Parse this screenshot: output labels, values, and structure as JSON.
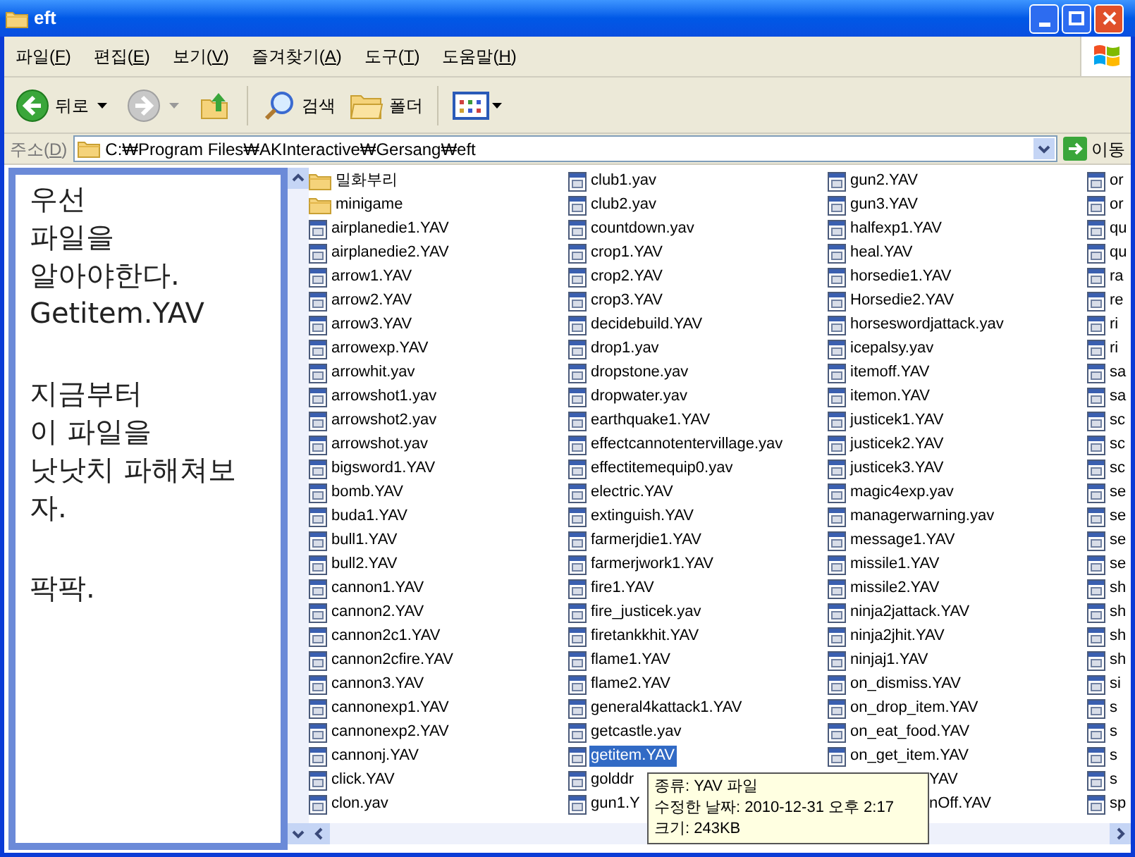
{
  "window": {
    "title": "eft"
  },
  "menu": [
    {
      "label": "파일(F)"
    },
    {
      "label": "편집(E)"
    },
    {
      "label": "보기(V)"
    },
    {
      "label": "즐겨찾기(A)"
    },
    {
      "label": "도구(T)"
    },
    {
      "label": "도움말(H)"
    }
  ],
  "toolbar": {
    "back": "뒤로",
    "search": "검색",
    "folders": "폴더"
  },
  "address": {
    "label": "주소(D)",
    "path": "C:₩Program Files₩AKInteractive₩Gersang₩eft",
    "go": "이동"
  },
  "note": {
    "paragraphs": [
      [
        "우선",
        "파일을",
        "알아야한다.",
        "Getitem.YAV"
      ],
      [
        "지금부터",
        "이 파일을",
        "낫낫치 파해쳐보",
        "자."
      ],
      [
        "팍팍."
      ]
    ]
  },
  "files": {
    "columns": [
      [
        {
          "name": "밀화부리",
          "kind": "folder",
          "selected": false
        },
        {
          "name": "minigame",
          "kind": "folder",
          "selected": false
        },
        {
          "name": "airplanedie1.YAV",
          "kind": "file",
          "selected": false
        },
        {
          "name": "airplanedie2.YAV",
          "kind": "file",
          "selected": false
        },
        {
          "name": "arrow1.YAV",
          "kind": "file",
          "selected": false
        },
        {
          "name": "arrow2.YAV",
          "kind": "file",
          "selected": false
        },
        {
          "name": "arrow3.YAV",
          "kind": "file",
          "selected": false
        },
        {
          "name": "arrowexp.YAV",
          "kind": "file",
          "selected": false
        },
        {
          "name": "arrowhit.yav",
          "kind": "file",
          "selected": false
        },
        {
          "name": "arrowshot1.yav",
          "kind": "file",
          "selected": false
        },
        {
          "name": "arrowshot2.yav",
          "kind": "file",
          "selected": false
        },
        {
          "name": "arrowshot.yav",
          "kind": "file",
          "selected": false
        },
        {
          "name": "bigsword1.YAV",
          "kind": "file",
          "selected": false
        },
        {
          "name": "bomb.YAV",
          "kind": "file",
          "selected": false
        },
        {
          "name": "buda1.YAV",
          "kind": "file",
          "selected": false
        },
        {
          "name": "bull1.YAV",
          "kind": "file",
          "selected": false
        },
        {
          "name": "bull2.YAV",
          "kind": "file",
          "selected": false
        },
        {
          "name": "cannon1.YAV",
          "kind": "file",
          "selected": false
        },
        {
          "name": "cannon2.YAV",
          "kind": "file",
          "selected": false
        },
        {
          "name": "cannon2c1.YAV",
          "kind": "file",
          "selected": false
        },
        {
          "name": "cannon2cfire.YAV",
          "kind": "file",
          "selected": false
        },
        {
          "name": "cannon3.YAV",
          "kind": "file",
          "selected": false
        },
        {
          "name": "cannonexp1.YAV",
          "kind": "file",
          "selected": false
        },
        {
          "name": "cannonexp2.YAV",
          "kind": "file",
          "selected": false
        },
        {
          "name": "cannonj.YAV",
          "kind": "file",
          "selected": false
        },
        {
          "name": "click.YAV",
          "kind": "file",
          "selected": false
        },
        {
          "name": "clon.yav",
          "kind": "file",
          "selected": false
        }
      ],
      [
        {
          "name": "club1.yav",
          "kind": "file",
          "selected": false
        },
        {
          "name": "club2.yav",
          "kind": "file",
          "selected": false
        },
        {
          "name": "countdown.yav",
          "kind": "file",
          "selected": false
        },
        {
          "name": "crop1.YAV",
          "kind": "file",
          "selected": false
        },
        {
          "name": "crop2.YAV",
          "kind": "file",
          "selected": false
        },
        {
          "name": "crop3.YAV",
          "kind": "file",
          "selected": false
        },
        {
          "name": "decidebuild.YAV",
          "kind": "file",
          "selected": false
        },
        {
          "name": "drop1.yav",
          "kind": "file",
          "selected": false
        },
        {
          "name": "dropstone.yav",
          "kind": "file",
          "selected": false
        },
        {
          "name": "dropwater.yav",
          "kind": "file",
          "selected": false
        },
        {
          "name": "earthquake1.YAV",
          "kind": "file",
          "selected": false
        },
        {
          "name": "effectcannotentervillage.yav",
          "kind": "file",
          "selected": false
        },
        {
          "name": "effectitemequip0.yav",
          "kind": "file",
          "selected": false
        },
        {
          "name": "electric.YAV",
          "kind": "file",
          "selected": false
        },
        {
          "name": "extinguish.YAV",
          "kind": "file",
          "selected": false
        },
        {
          "name": "farmerjdie1.YAV",
          "kind": "file",
          "selected": false
        },
        {
          "name": "farmerjwork1.YAV",
          "kind": "file",
          "selected": false
        },
        {
          "name": "fire1.YAV",
          "kind": "file",
          "selected": false
        },
        {
          "name": "fire_justicek.yav",
          "kind": "file",
          "selected": false
        },
        {
          "name": "firetankkhit.YAV",
          "kind": "file",
          "selected": false
        },
        {
          "name": "flame1.YAV",
          "kind": "file",
          "selected": false
        },
        {
          "name": "flame2.YAV",
          "kind": "file",
          "selected": false
        },
        {
          "name": "general4kattack1.YAV",
          "kind": "file",
          "selected": false
        },
        {
          "name": "getcastle.yav",
          "kind": "file",
          "selected": false
        },
        {
          "name": "getitem.YAV",
          "kind": "file",
          "selected": true
        },
        {
          "name": "golddr",
          "kind": "file",
          "selected": false
        },
        {
          "name": "gun1.Y",
          "kind": "file",
          "selected": false
        }
      ],
      [
        {
          "name": "gun2.YAV",
          "kind": "file",
          "selected": false
        },
        {
          "name": "gun3.YAV",
          "kind": "file",
          "selected": false
        },
        {
          "name": "halfexp1.YAV",
          "kind": "file",
          "selected": false
        },
        {
          "name": "heal.YAV",
          "kind": "file",
          "selected": false
        },
        {
          "name": "horsedie1.YAV",
          "kind": "file",
          "selected": false
        },
        {
          "name": "Horsedie2.YAV",
          "kind": "file",
          "selected": false
        },
        {
          "name": "horseswordjattack.yav",
          "kind": "file",
          "selected": false
        },
        {
          "name": "icepalsy.yav",
          "kind": "file",
          "selected": false
        },
        {
          "name": "itemoff.YAV",
          "kind": "file",
          "selected": false
        },
        {
          "name": "itemon.YAV",
          "kind": "file",
          "selected": false
        },
        {
          "name": "justicek1.YAV",
          "kind": "file",
          "selected": false
        },
        {
          "name": "justicek2.YAV",
          "kind": "file",
          "selected": false
        },
        {
          "name": "justicek3.YAV",
          "kind": "file",
          "selected": false
        },
        {
          "name": "magic4exp.yav",
          "kind": "file",
          "selected": false
        },
        {
          "name": "managerwarning.yav",
          "kind": "file",
          "selected": false
        },
        {
          "name": "message1.YAV",
          "kind": "file",
          "selected": false
        },
        {
          "name": "missile1.YAV",
          "kind": "file",
          "selected": false
        },
        {
          "name": "missile2.YAV",
          "kind": "file",
          "selected": false
        },
        {
          "name": "ninja2jattack.YAV",
          "kind": "file",
          "selected": false
        },
        {
          "name": "ninja2jhit.YAV",
          "kind": "file",
          "selected": false
        },
        {
          "name": "ninjaj1.YAV",
          "kind": "file",
          "selected": false
        },
        {
          "name": "on_dismiss.YAV",
          "kind": "file",
          "selected": false
        },
        {
          "name": "on_drop_item.YAV",
          "kind": "file",
          "selected": false
        },
        {
          "name": "on_eat_food.YAV",
          "kind": "file",
          "selected": false
        },
        {
          "name": "on_get_item.YAV",
          "kind": "file",
          "selected": false
        },
        {
          "name": "YAV",
          "kind": "covered"
        },
        {
          "name": "nOff.YAV",
          "kind": "covered"
        }
      ],
      [
        {
          "name": "or",
          "kind": "file",
          "selected": false
        },
        {
          "name": "or",
          "kind": "file",
          "selected": false
        },
        {
          "name": "qu",
          "kind": "file",
          "selected": false
        },
        {
          "name": "qu",
          "kind": "file",
          "selected": false
        },
        {
          "name": "ra",
          "kind": "file",
          "selected": false
        },
        {
          "name": "re",
          "kind": "file",
          "selected": false
        },
        {
          "name": "ri",
          "kind": "file",
          "selected": false
        },
        {
          "name": "ri",
          "kind": "file",
          "selected": false
        },
        {
          "name": "sa",
          "kind": "file",
          "selected": false
        },
        {
          "name": "sa",
          "kind": "file",
          "selected": false
        },
        {
          "name": "sc",
          "kind": "file",
          "selected": false
        },
        {
          "name": "sc",
          "kind": "file",
          "selected": false
        },
        {
          "name": "sc",
          "kind": "file",
          "selected": false
        },
        {
          "name": "se",
          "kind": "file",
          "selected": false
        },
        {
          "name": "se",
          "kind": "file",
          "selected": false
        },
        {
          "name": "se",
          "kind": "file",
          "selected": false
        },
        {
          "name": "se",
          "kind": "file",
          "selected": false
        },
        {
          "name": "sh",
          "kind": "file",
          "selected": false
        },
        {
          "name": "sh",
          "kind": "file",
          "selected": false
        },
        {
          "name": "sh",
          "kind": "file",
          "selected": false
        },
        {
          "name": "sh",
          "kind": "file",
          "selected": false
        },
        {
          "name": "si",
          "kind": "file",
          "selected": false
        },
        {
          "name": "s",
          "kind": "file",
          "selected": false
        },
        {
          "name": "s",
          "kind": "file",
          "selected": false
        },
        {
          "name": "s",
          "kind": "file",
          "selected": false
        },
        {
          "name": "s",
          "kind": "file",
          "selected": false
        },
        {
          "name": "sp",
          "kind": "file",
          "selected": false
        }
      ]
    ]
  },
  "tooltip": {
    "lines": [
      "종류: YAV 파일",
      "수정한 날짜: 2010-12-31 오후 2:17",
      "크기: 243KB"
    ]
  }
}
